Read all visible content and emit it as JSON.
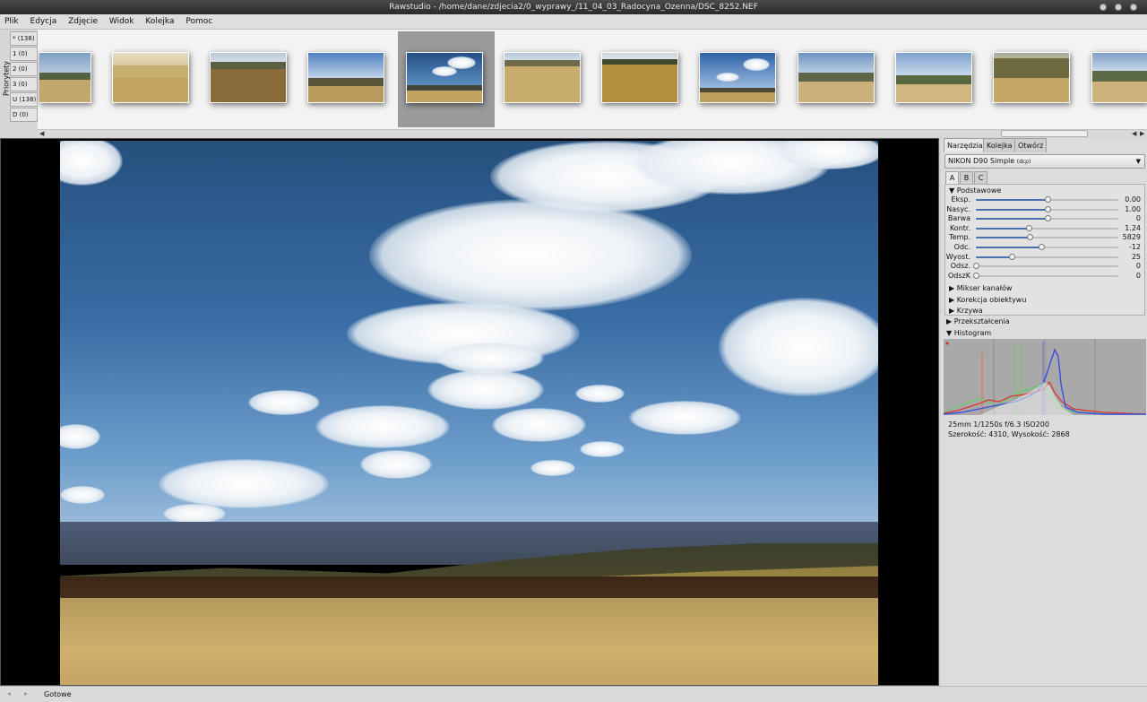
{
  "window": {
    "title": "Rawstudio - /home/dane/zdjecia2/0_wyprawy_/11_04_03_Radocyna_Ozenna/DSC_8252.NEF"
  },
  "menu": [
    "Plik",
    "Edycja",
    "Zdjęcie",
    "Widok",
    "Kolejka",
    "Pomoc"
  ],
  "priorities": {
    "label": "Priorytety",
    "items": [
      "* (138)",
      "1 (0)",
      "2 (0)",
      "3 (0)",
      "U (138)",
      "D (0)"
    ]
  },
  "tabs": [
    "Narzędzia",
    "Kolejka",
    "Otwórz"
  ],
  "profile": {
    "selected": "NIKON D90 Simple",
    "suffix": "(dcp)"
  },
  "snapshots": [
    "A",
    "B",
    "C"
  ],
  "basic": {
    "header": "Podstawowe",
    "sliders": [
      {
        "label": "Eksp.",
        "value": "0.00",
        "pos": 0.5
      },
      {
        "label": "Nasyc.",
        "value": "1.00",
        "pos": 0.5
      },
      {
        "label": "Barwa",
        "value": "0",
        "pos": 0.5
      },
      {
        "label": "Kontr.",
        "value": "1.24",
        "pos": 0.37
      },
      {
        "label": "Temp.",
        "value": "5829",
        "pos": 0.38
      },
      {
        "label": "Odc.",
        "value": "-12",
        "pos": 0.46
      },
      {
        "label": "Wyost.",
        "value": "25",
        "pos": 0.25
      },
      {
        "label": "Odsz.",
        "value": "0",
        "pos": 0.0
      },
      {
        "label": "OdszK",
        "value": "0",
        "pos": 0.0
      }
    ]
  },
  "sections": {
    "mixer": "Mikser kanałów",
    "lens": "Korekcja obiektywu",
    "curves": "Krzywa",
    "transforms": "Przekształcenia",
    "histogram": "Histogram"
  },
  "exif": {
    "line1": "25mm 1/1250s f/6.3 ISO200",
    "line2": "Szerokość: 4310, Wysokość: 2868"
  },
  "status": {
    "text": "Gotowe"
  },
  "colors": {
    "slider_fill": "#4a6fae",
    "selected_thumb_bg": "#9a9a9a"
  }
}
